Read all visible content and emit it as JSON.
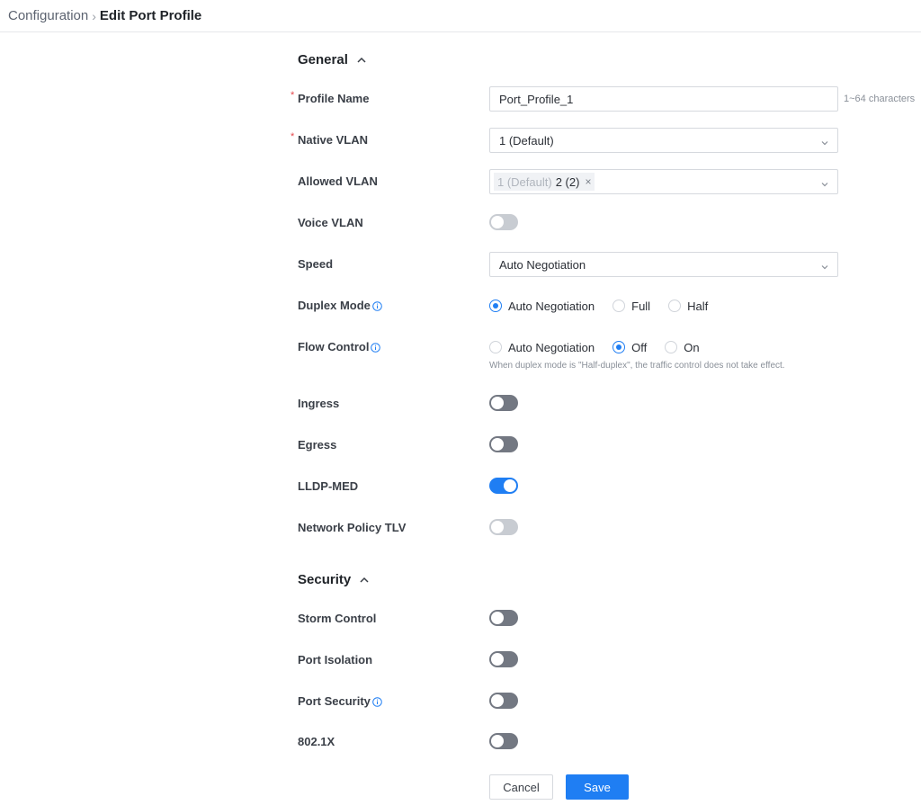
{
  "breadcrumb": {
    "parent": "Configuration",
    "separator": "›",
    "current": "Edit Port Profile"
  },
  "general": {
    "title": "General",
    "profile_name": {
      "label": "Profile Name",
      "required_mark": "*",
      "value": "Port_Profile_1",
      "hint": "1~64 characters"
    },
    "native_vlan": {
      "label": "Native VLAN",
      "required_mark": "*",
      "value": "1 (Default)"
    },
    "allowed_vlan": {
      "label": "Allowed VLAN",
      "tag_disabled": "1 (Default)",
      "tag_value": "2 (2)",
      "tag_remove": "×"
    },
    "voice_vlan": {
      "label": "Voice VLAN",
      "state": "off-disabled"
    },
    "speed": {
      "label": "Speed",
      "value": "Auto Negotiation"
    },
    "duplex_mode": {
      "label": "Duplex Mode",
      "options": [
        "Auto Negotiation",
        "Full",
        "Half"
      ],
      "selected": "Auto Negotiation"
    },
    "flow_control": {
      "label": "Flow Control",
      "options": [
        "Auto Negotiation",
        "Off",
        "On"
      ],
      "selected": "Off",
      "note": "When duplex mode is \"Half-duplex\", the traffic control does not take effect."
    },
    "ingress": {
      "label": "Ingress",
      "state": "off"
    },
    "egress": {
      "label": "Egress",
      "state": "off"
    },
    "lldp_med": {
      "label": "LLDP-MED",
      "state": "on"
    },
    "network_policy_tlv": {
      "label": "Network Policy TLV",
      "state": "off-disabled"
    }
  },
  "security": {
    "title": "Security",
    "storm_control": {
      "label": "Storm Control",
      "state": "off"
    },
    "port_isolation": {
      "label": "Port Isolation",
      "state": "off"
    },
    "port_security": {
      "label": "Port Security",
      "state": "off"
    },
    "dot1x": {
      "label": "802.1X",
      "state": "off"
    }
  },
  "actions": {
    "cancel": "Cancel",
    "save": "Save"
  },
  "colors": {
    "accent": "#1f7ef3",
    "required": "#e5484d",
    "switch_off": "#737882",
    "switch_disabled": "#c8ccd2"
  },
  "icons": {
    "collapse": "chevron-up-icon",
    "dropdown": "chevron-down-icon",
    "info": "info-circle-icon"
  }
}
